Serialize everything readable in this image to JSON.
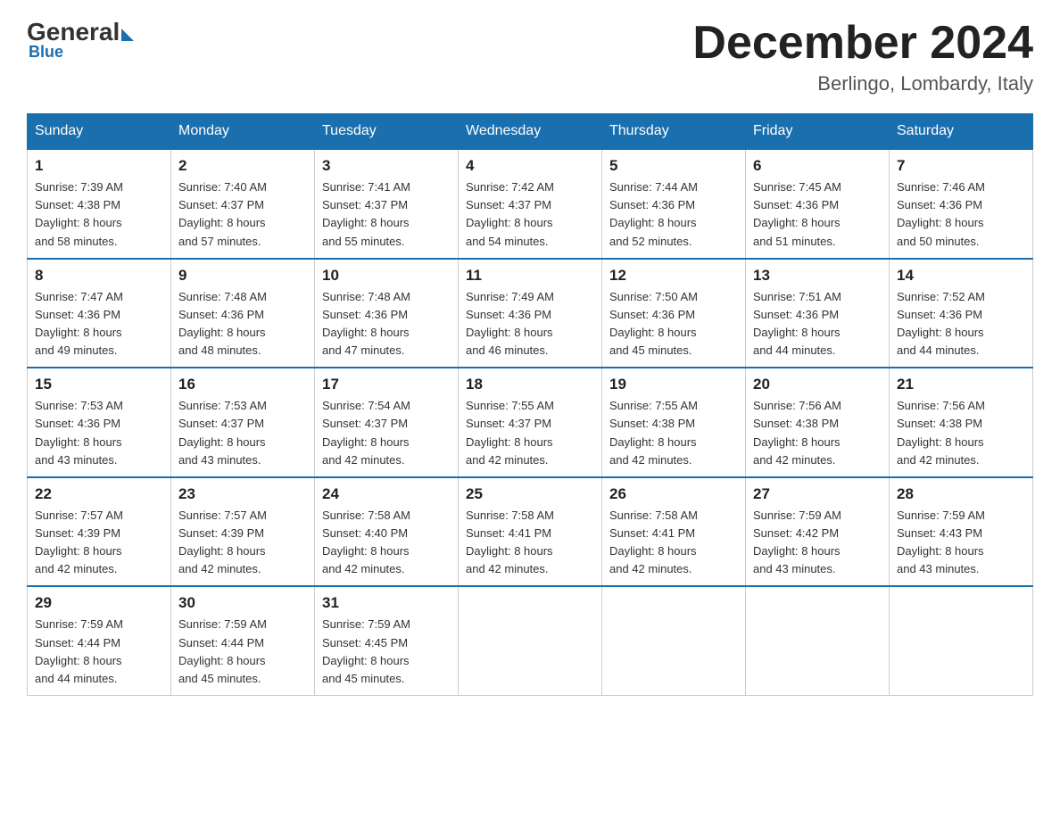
{
  "logo": {
    "general": "General",
    "blue": "Blue"
  },
  "title": "December 2024",
  "location": "Berlingo, Lombardy, Italy",
  "headers": [
    "Sunday",
    "Monday",
    "Tuesday",
    "Wednesday",
    "Thursday",
    "Friday",
    "Saturday"
  ],
  "weeks": [
    [
      {
        "day": "1",
        "sunrise": "7:39 AM",
        "sunset": "4:38 PM",
        "daylight": "8 hours and 58 minutes."
      },
      {
        "day": "2",
        "sunrise": "7:40 AM",
        "sunset": "4:37 PM",
        "daylight": "8 hours and 57 minutes."
      },
      {
        "day": "3",
        "sunrise": "7:41 AM",
        "sunset": "4:37 PM",
        "daylight": "8 hours and 55 minutes."
      },
      {
        "day": "4",
        "sunrise": "7:42 AM",
        "sunset": "4:37 PM",
        "daylight": "8 hours and 54 minutes."
      },
      {
        "day": "5",
        "sunrise": "7:44 AM",
        "sunset": "4:36 PM",
        "daylight": "8 hours and 52 minutes."
      },
      {
        "day": "6",
        "sunrise": "7:45 AM",
        "sunset": "4:36 PM",
        "daylight": "8 hours and 51 minutes."
      },
      {
        "day": "7",
        "sunrise": "7:46 AM",
        "sunset": "4:36 PM",
        "daylight": "8 hours and 50 minutes."
      }
    ],
    [
      {
        "day": "8",
        "sunrise": "7:47 AM",
        "sunset": "4:36 PM",
        "daylight": "8 hours and 49 minutes."
      },
      {
        "day": "9",
        "sunrise": "7:48 AM",
        "sunset": "4:36 PM",
        "daylight": "8 hours and 48 minutes."
      },
      {
        "day": "10",
        "sunrise": "7:48 AM",
        "sunset": "4:36 PM",
        "daylight": "8 hours and 47 minutes."
      },
      {
        "day": "11",
        "sunrise": "7:49 AM",
        "sunset": "4:36 PM",
        "daylight": "8 hours and 46 minutes."
      },
      {
        "day": "12",
        "sunrise": "7:50 AM",
        "sunset": "4:36 PM",
        "daylight": "8 hours and 45 minutes."
      },
      {
        "day": "13",
        "sunrise": "7:51 AM",
        "sunset": "4:36 PM",
        "daylight": "8 hours and 44 minutes."
      },
      {
        "day": "14",
        "sunrise": "7:52 AM",
        "sunset": "4:36 PM",
        "daylight": "8 hours and 44 minutes."
      }
    ],
    [
      {
        "day": "15",
        "sunrise": "7:53 AM",
        "sunset": "4:36 PM",
        "daylight": "8 hours and 43 minutes."
      },
      {
        "day": "16",
        "sunrise": "7:53 AM",
        "sunset": "4:37 PM",
        "daylight": "8 hours and 43 minutes."
      },
      {
        "day": "17",
        "sunrise": "7:54 AM",
        "sunset": "4:37 PM",
        "daylight": "8 hours and 42 minutes."
      },
      {
        "day": "18",
        "sunrise": "7:55 AM",
        "sunset": "4:37 PM",
        "daylight": "8 hours and 42 minutes."
      },
      {
        "day": "19",
        "sunrise": "7:55 AM",
        "sunset": "4:38 PM",
        "daylight": "8 hours and 42 minutes."
      },
      {
        "day": "20",
        "sunrise": "7:56 AM",
        "sunset": "4:38 PM",
        "daylight": "8 hours and 42 minutes."
      },
      {
        "day": "21",
        "sunrise": "7:56 AM",
        "sunset": "4:38 PM",
        "daylight": "8 hours and 42 minutes."
      }
    ],
    [
      {
        "day": "22",
        "sunrise": "7:57 AM",
        "sunset": "4:39 PM",
        "daylight": "8 hours and 42 minutes."
      },
      {
        "day": "23",
        "sunrise": "7:57 AM",
        "sunset": "4:39 PM",
        "daylight": "8 hours and 42 minutes."
      },
      {
        "day": "24",
        "sunrise": "7:58 AM",
        "sunset": "4:40 PM",
        "daylight": "8 hours and 42 minutes."
      },
      {
        "day": "25",
        "sunrise": "7:58 AM",
        "sunset": "4:41 PM",
        "daylight": "8 hours and 42 minutes."
      },
      {
        "day": "26",
        "sunrise": "7:58 AM",
        "sunset": "4:41 PM",
        "daylight": "8 hours and 42 minutes."
      },
      {
        "day": "27",
        "sunrise": "7:59 AM",
        "sunset": "4:42 PM",
        "daylight": "8 hours and 43 minutes."
      },
      {
        "day": "28",
        "sunrise": "7:59 AM",
        "sunset": "4:43 PM",
        "daylight": "8 hours and 43 minutes."
      }
    ],
    [
      {
        "day": "29",
        "sunrise": "7:59 AM",
        "sunset": "4:44 PM",
        "daylight": "8 hours and 44 minutes."
      },
      {
        "day": "30",
        "sunrise": "7:59 AM",
        "sunset": "4:44 PM",
        "daylight": "8 hours and 45 minutes."
      },
      {
        "day": "31",
        "sunrise": "7:59 AM",
        "sunset": "4:45 PM",
        "daylight": "8 hours and 45 minutes."
      },
      null,
      null,
      null,
      null
    ]
  ],
  "labels": {
    "sunrise": "Sunrise:",
    "sunset": "Sunset:",
    "daylight": "Daylight:"
  }
}
